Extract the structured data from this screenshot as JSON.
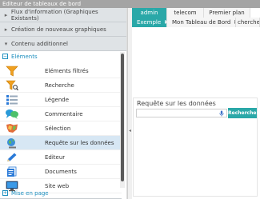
{
  "app": {
    "title": "Editeur de tableaux de bord"
  },
  "sidebar": {
    "accordions": [
      {
        "label": "Flux d'information (Graphiques Existants)"
      },
      {
        "label": "Création de nouveaux graphiques"
      },
      {
        "label": "Contenu additionnel"
      }
    ],
    "section_elements": "Eléments",
    "items": [
      {
        "label": "Eléments filtrés",
        "icon": "funnel-icon"
      },
      {
        "label": "Recherche",
        "icon": "search-funnel-icon"
      },
      {
        "label": "Légende",
        "icon": "legend-icon"
      },
      {
        "label": "Commentaire",
        "icon": "comment-icon"
      },
      {
        "label": "Sélection",
        "icon": "map-selection-icon"
      },
      {
        "label": "Requête sur les données",
        "icon": "globe-query-icon"
      },
      {
        "label": "Editeur",
        "icon": "pencil-icon"
      },
      {
        "label": "Documents",
        "icon": "documents-icon"
      },
      {
        "label": "Site web",
        "icon": "monitor-icon"
      }
    ],
    "section_mise": "Mise en page"
  },
  "tabs": {
    "row1": [
      "admin",
      "telecom",
      "Premier plan"
    ],
    "row2": [
      {
        "label": "Exemple",
        "close": "✖"
      },
      {
        "label": "Mon Tableau de Bord",
        "close": "✖"
      },
      {
        "label": "cherche"
      }
    ]
  },
  "query": {
    "title": "Requête sur les données",
    "input_value": "",
    "button_label": "Rechercher"
  },
  "colors": {
    "accent": "#2aa8a8",
    "link": "#1e8fbf",
    "selected": "#d7e7f4"
  }
}
